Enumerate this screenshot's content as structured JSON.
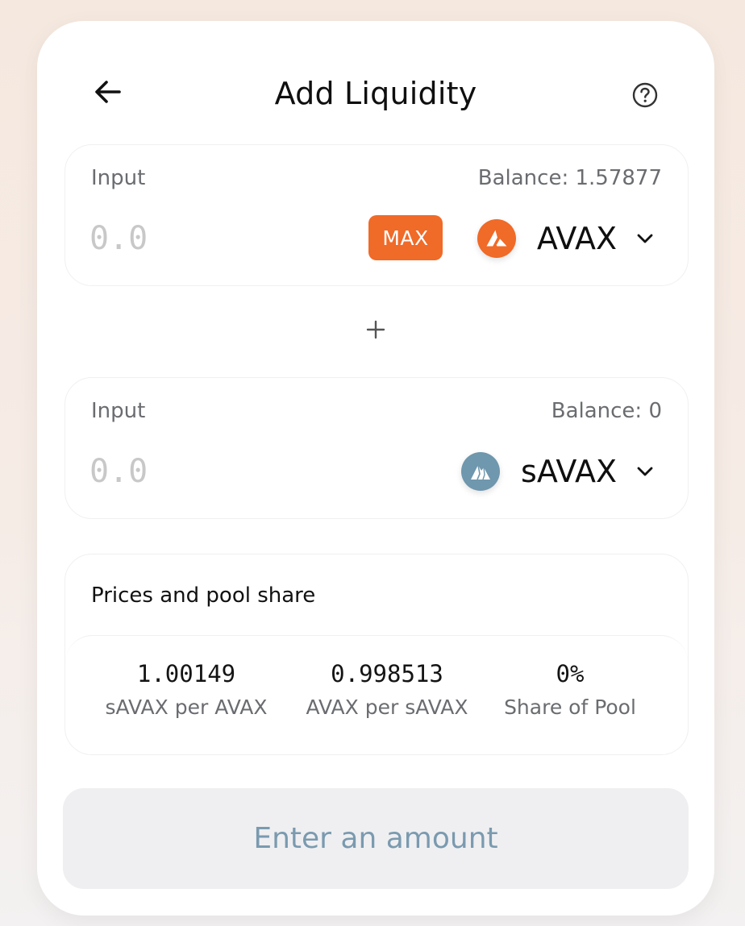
{
  "header": {
    "title": "Add Liquidity",
    "back_icon": "arrow-left-icon",
    "help_icon": "question-circle-icon"
  },
  "input_a": {
    "label": "Input",
    "balance": "Balance: 1.57877",
    "placeholder": "0.0",
    "max_label": "MAX",
    "token": "AVAX",
    "token_icon": "avax-logo-icon",
    "token_color": "#f06a28"
  },
  "plus_icon": "plus-icon",
  "input_b": {
    "label": "Input",
    "balance": "Balance: 0",
    "placeholder": "0.0",
    "token": "sAVAX",
    "token_icon": "savax-logo-icon",
    "token_color": "#6f97ad"
  },
  "prices": {
    "title": "Prices and pool share",
    "items": [
      {
        "value": "1.00149",
        "label": "sAVAX per AVAX"
      },
      {
        "value": "0.998513",
        "label": "AVAX per sAVAX"
      },
      {
        "value": "0%",
        "label": "Share of Pool"
      }
    ]
  },
  "submit": {
    "label": "Enter an amount"
  },
  "colors": {
    "accent": "#f06a28",
    "disabled_text": "#7a9aaf",
    "disabled_bg": "#efeff1"
  }
}
